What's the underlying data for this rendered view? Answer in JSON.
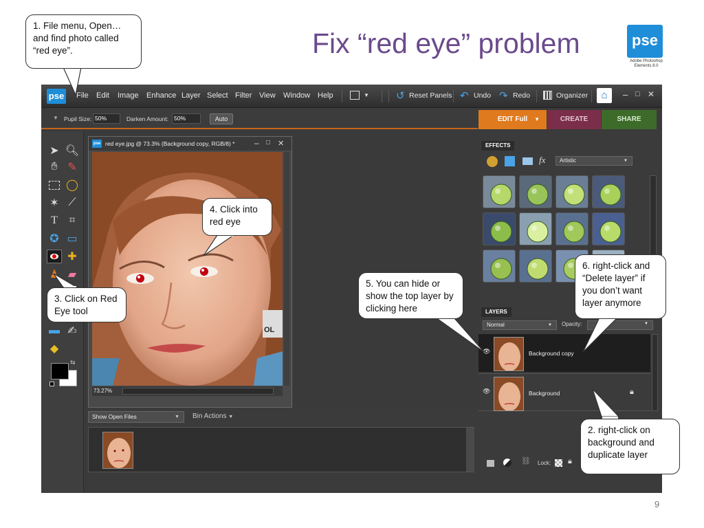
{
  "slide": {
    "title": "Fix “red eye” problem",
    "logo_text": "pse",
    "logo_caption": "Adobe Photoshop Elements 8.0",
    "page_number": "9"
  },
  "callouts": {
    "c1": "1. File menu, Open… and find photo called “red eye”.",
    "c2": "2. right-click on background and duplicate layer",
    "c3": "3. Click on Red Eye tool",
    "c4": "4. Click into red eye",
    "c5": "5. You can hide or show the top layer by clicking here",
    "c6": "6. right-click and “Delete layer” if you don’t want layer anymore"
  },
  "app": {
    "logo": "pse",
    "menu": [
      "File",
      "Edit",
      "Image",
      "Enhance",
      "Layer",
      "Select",
      "Filter",
      "View",
      "Window",
      "Help"
    ],
    "toolbar": {
      "reset_panels": "Reset Panels",
      "undo": "Undo",
      "redo": "Redo",
      "organizer": "Organizer"
    },
    "options": {
      "pupil_label": "Pupil Size:",
      "pupil_value": "50%",
      "darken_label": "Darken Amount:",
      "darken_value": "50%",
      "auto_label": "Auto"
    },
    "modes": {
      "edit": "EDIT Full",
      "create": "CREATE",
      "share": "SHARE",
      "edit_color": "#e07a1e",
      "create_color": "#7a2e4a",
      "share_color": "#3d6b2a"
    },
    "document": {
      "title": "red eye.jpg @ 73.3% (Background copy, RGB/8) *",
      "zoom": "73.27%"
    },
    "bin": {
      "show_select": "Show Open Files",
      "actions": "Bin Actions"
    },
    "effects": {
      "tab": "EFFECTS",
      "category": "Artistic"
    },
    "layers": {
      "tab": "LAYERS",
      "blend_mode": "Normal",
      "opacity_label": "Opacity:",
      "lock_label": "Lock:",
      "items": [
        {
          "name": "Background copy",
          "selected": true,
          "visible": true
        },
        {
          "name": "Background",
          "selected": false,
          "visible": true,
          "locked": true
        }
      ]
    }
  }
}
